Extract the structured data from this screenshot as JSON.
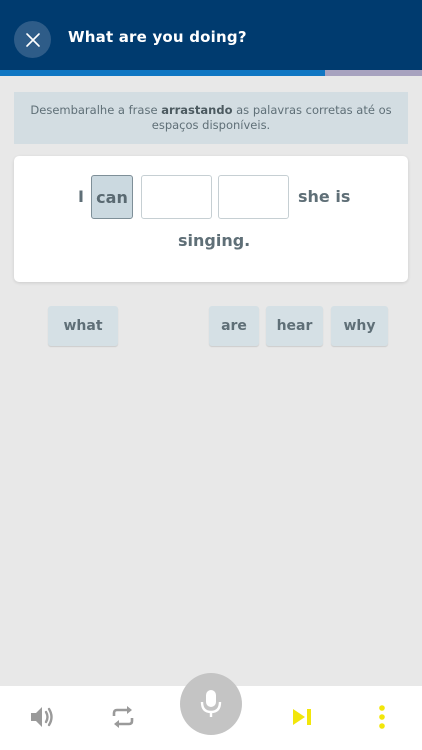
{
  "header": {
    "title": "What are you doing?",
    "progress_fraction": 0.77
  },
  "instruction": {
    "part1": "Desembaralhe a frase ",
    "bold": "arrastando",
    "part2": " as palavras corretas até os espaços disponíveis."
  },
  "sentence": {
    "word_i": "I",
    "placed_word": "can",
    "word_she_is": "she is",
    "word_singing": "singing."
  },
  "word_bank": {
    "chip_1": "what",
    "chip_2": "are",
    "chip_3": "hear",
    "chip_4": "why"
  },
  "toolbar": {
    "icons": [
      "volume-icon",
      "repeat-icon",
      "microphone-icon",
      "skip-next-icon",
      "more-vertical-icon"
    ],
    "accent_color": "#f2e60a"
  },
  "colors": {
    "header_bg": "#003b6f",
    "progress": "#0f76c2",
    "background": "#e8e8e8"
  }
}
